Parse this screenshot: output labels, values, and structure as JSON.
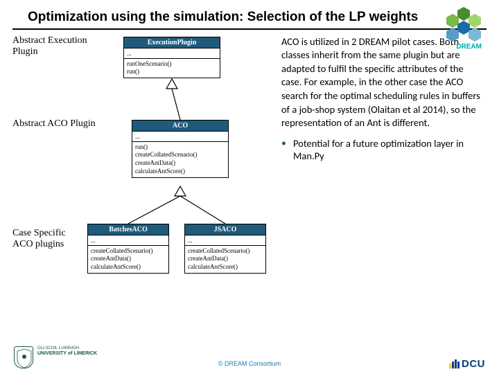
{
  "title": "Optimization using the simulation: Selection of the LP weights",
  "brand": "DREAM",
  "labels": {
    "abstractExec": "Abstract Execution Plugin",
    "abstractAco": "Abstract ACO Plugin",
    "caseSpecific": "Case Specific ACO plugins"
  },
  "boxes": {
    "exec": {
      "header": "ExecutionPlugin",
      "attrs": "...",
      "methods": [
        "runOneScenario()",
        "run()"
      ]
    },
    "aco": {
      "header": "ACO",
      "attrs": "...",
      "methods": [
        "run()",
        "createCollatedScenario()",
        "createAntData()",
        "calculateAntScore()"
      ]
    },
    "batches": {
      "header": "BatchesACO",
      "attrs": "...",
      "methods": [
        "createCollatedScenario()",
        "createAntData()",
        "calculateAntScore()"
      ]
    },
    "js": {
      "header": "JSACO",
      "attrs": "...",
      "methods": [
        "createCollatedScenario()",
        "createAntData()",
        "calculateAntScore()"
      ]
    }
  },
  "bodyText": "ACO is utilized in 2 DREAM pilot cases. Both classes inherit from the same plugin but are adapted to fulfil the specific attributes of the case. For example, in the other case the ACO search for the optimal scheduling rules in buffers of a job-shop system (Olaitan et al 2014), so the representation of an Ant is different.",
  "bullet": "Potential for a future optimization layer in Man.Py",
  "univ": {
    "line1": "OLLSCOIL LUIMNIGH",
    "line2": "UNIVERSITY of LIMERICK"
  },
  "copyright": "© DREAM Consortium",
  "dcu": "DCU"
}
